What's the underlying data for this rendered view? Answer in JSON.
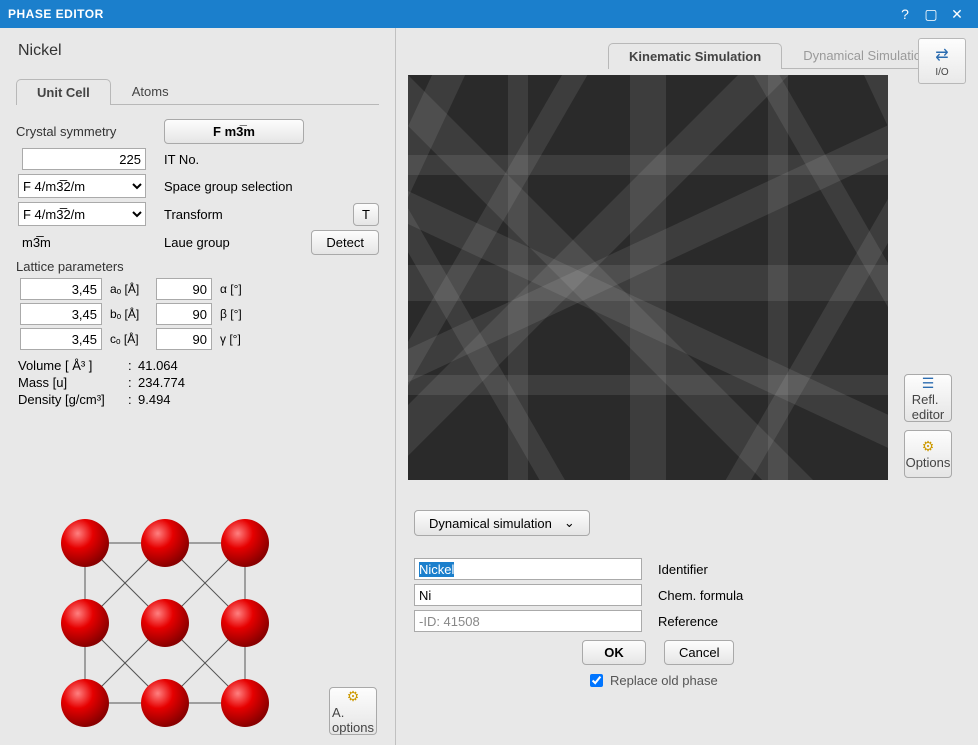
{
  "window": {
    "title": "PHASE EDITOR"
  },
  "io_button": "I/O",
  "phase_name": "Nickel",
  "left_tabs": {
    "unit_cell": "Unit Cell",
    "atoms": "Atoms"
  },
  "symmetry": {
    "section": "Crystal symmetry",
    "button_f": "F m3̅m",
    "it_no_value": "225",
    "it_no_label": "IT No.",
    "sg1_value": "F 4/m3̅2/m",
    "sg_label": "Space group selection",
    "tr_value": "F 4/m3̅2/m",
    "tr_label": "Transform",
    "t_btn": "T",
    "laue_value": "m3̅m",
    "laue_label": "Laue group",
    "detect_btn": "Detect"
  },
  "lattice": {
    "section": "Lattice parameters",
    "a": "3,45",
    "b": "3,45",
    "c": "3,45",
    "a_unit": "aₒ [Å]",
    "b_unit": "bₒ [Å]",
    "c_unit": "cₒ [Å]",
    "alpha": "90",
    "beta": "90",
    "gamma": "90",
    "alpha_unit": "α [°]",
    "beta_unit": "β [°]",
    "gamma_unit": "γ [°]"
  },
  "info": {
    "vol_label": "Volume [ Å³ ]",
    "vol_val": "41.064",
    "mass_label": "Mass [u]",
    "mass_val": "234.774",
    "dens_label": "Density [g/cm³]",
    "dens_val": "9.494"
  },
  "a_options": "A. options",
  "right_tabs": {
    "kin": "Kinematic Simulation",
    "dyn": "Dynamical Simulation"
  },
  "side_buttons": {
    "refl": "Refl. editor",
    "opt": "Options"
  },
  "dyn_btn": "Dynamical simulation",
  "fields": {
    "identifier_val": "Nickel",
    "identifier_lbl": "Identifier",
    "formula_val": "Ni",
    "formula_lbl": "Chem. formula",
    "reference_val": "-ID: 41508",
    "reference_lbl": "Reference"
  },
  "ok": "OK",
  "cancel": "Cancel",
  "replace_old": "Replace old phase"
}
